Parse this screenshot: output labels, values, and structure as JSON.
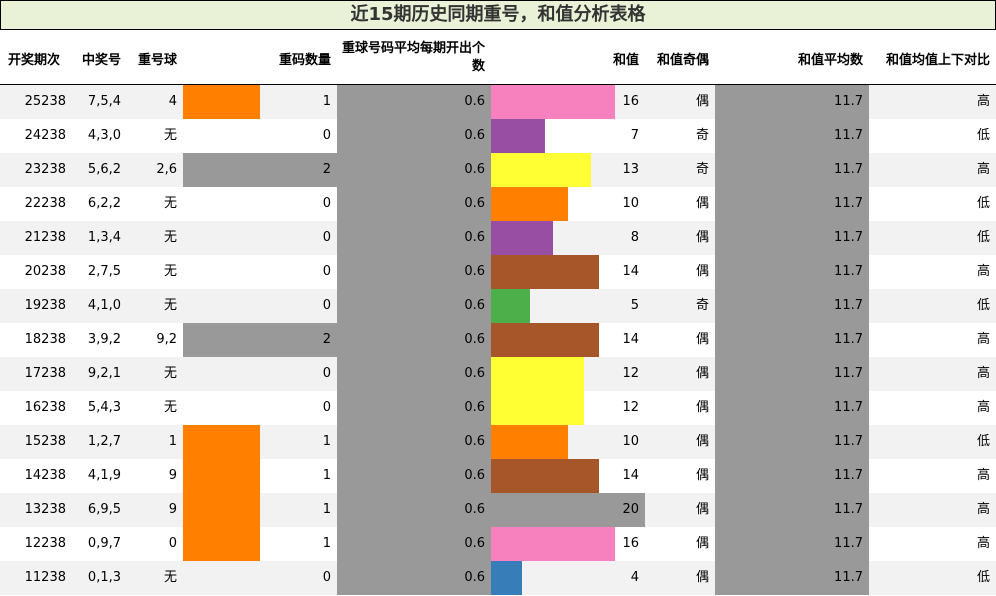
{
  "title": "近15期历史同期重号，和值分析表格",
  "headers": {
    "period": "开奖期次",
    "numbers": "中奖号",
    "repeat_ball": "重号球",
    "repeat_count": "重码数量",
    "avg_repeat": "重球号码平均每期开出个数",
    "sum": "和值",
    "parity": "和值奇偶",
    "sum_avg": "和值平均数",
    "compare": "和值均值上下对比"
  },
  "colors": {
    "orange": "#ff7f00",
    "gray": "#999999",
    "pink": "#f781bf",
    "purple": "#984ea3",
    "yellow": "#ffff33",
    "brown": "#a65628",
    "green": "#4daf4a",
    "blue": "#377eb8"
  },
  "chart_data": {
    "type": "table",
    "rows": [
      {
        "period": "25238",
        "numbers": "7,5,4",
        "repeat_ball": "4",
        "repeat_count": 1,
        "avg_repeat": "0.6",
        "sum": 16,
        "parity": "偶",
        "sum_avg": "11.7",
        "compare": "高"
      },
      {
        "period": "24238",
        "numbers": "4,3,0",
        "repeat_ball": "无",
        "repeat_count": 0,
        "avg_repeat": "0.6",
        "sum": 7,
        "parity": "奇",
        "sum_avg": "11.7",
        "compare": "低"
      },
      {
        "period": "23238",
        "numbers": "5,6,2",
        "repeat_ball": "2,6",
        "repeat_count": 2,
        "avg_repeat": "0.6",
        "sum": 13,
        "parity": "奇",
        "sum_avg": "11.7",
        "compare": "高"
      },
      {
        "period": "22238",
        "numbers": "6,2,2",
        "repeat_ball": "无",
        "repeat_count": 0,
        "avg_repeat": "0.6",
        "sum": 10,
        "parity": "偶",
        "sum_avg": "11.7",
        "compare": "低"
      },
      {
        "period": "21238",
        "numbers": "1,3,4",
        "repeat_ball": "无",
        "repeat_count": 0,
        "avg_repeat": "0.6",
        "sum": 8,
        "parity": "偶",
        "sum_avg": "11.7",
        "compare": "低"
      },
      {
        "period": "20238",
        "numbers": "2,7,5",
        "repeat_ball": "无",
        "repeat_count": 0,
        "avg_repeat": "0.6",
        "sum": 14,
        "parity": "偶",
        "sum_avg": "11.7",
        "compare": "高"
      },
      {
        "period": "19238",
        "numbers": "4,1,0",
        "repeat_ball": "无",
        "repeat_count": 0,
        "avg_repeat": "0.6",
        "sum": 5,
        "parity": "奇",
        "sum_avg": "11.7",
        "compare": "低"
      },
      {
        "period": "18238",
        "numbers": "3,9,2",
        "repeat_ball": "9,2",
        "repeat_count": 2,
        "avg_repeat": "0.6",
        "sum": 14,
        "parity": "偶",
        "sum_avg": "11.7",
        "compare": "高"
      },
      {
        "period": "17238",
        "numbers": "9,2,1",
        "repeat_ball": "无",
        "repeat_count": 0,
        "avg_repeat": "0.6",
        "sum": 12,
        "parity": "偶",
        "sum_avg": "11.7",
        "compare": "高"
      },
      {
        "period": "16238",
        "numbers": "5,4,3",
        "repeat_ball": "无",
        "repeat_count": 0,
        "avg_repeat": "0.6",
        "sum": 12,
        "parity": "偶",
        "sum_avg": "11.7",
        "compare": "高"
      },
      {
        "period": "15238",
        "numbers": "1,2,7",
        "repeat_ball": "1",
        "repeat_count": 1,
        "avg_repeat": "0.6",
        "sum": 10,
        "parity": "偶",
        "sum_avg": "11.7",
        "compare": "低"
      },
      {
        "period": "14238",
        "numbers": "4,1,9",
        "repeat_ball": "9",
        "repeat_count": 1,
        "avg_repeat": "0.6",
        "sum": 14,
        "parity": "偶",
        "sum_avg": "11.7",
        "compare": "高"
      },
      {
        "period": "13238",
        "numbers": "6,9,5",
        "repeat_ball": "9",
        "repeat_count": 1,
        "avg_repeat": "0.6",
        "sum": 20,
        "parity": "偶",
        "sum_avg": "11.7",
        "compare": "高"
      },
      {
        "period": "12238",
        "numbers": "0,9,7",
        "repeat_ball": "0",
        "repeat_count": 1,
        "avg_repeat": "0.6",
        "sum": 16,
        "parity": "偶",
        "sum_avg": "11.7",
        "compare": "高"
      },
      {
        "period": "11238",
        "numbers": "0,1,3",
        "repeat_ball": "无",
        "repeat_count": 0,
        "avg_repeat": "0.6",
        "sum": 4,
        "parity": "偶",
        "sum_avg": "11.7",
        "compare": "低"
      }
    ],
    "sum_colors": {
      "4": "blue",
      "5": "green",
      "7": "purple",
      "8": "purple",
      "10": "orange",
      "12": "yellow",
      "13": "yellow",
      "14": "brown",
      "16": "pink",
      "20": "gray"
    },
    "repeat_count_colors": {
      "1": "orange",
      "2": "gray"
    }
  }
}
